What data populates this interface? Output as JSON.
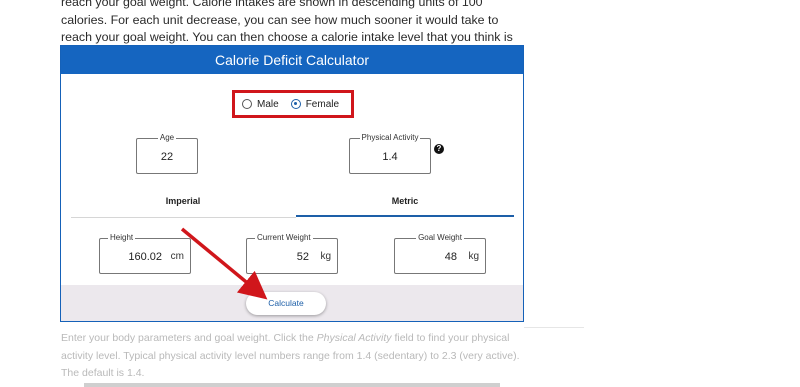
{
  "intro_text": "reach your goal weight. Calorie intakes are shown in descending units of 100 calories. For each unit decrease, you can see how much sooner it would take to reach your goal weight. You can then choose a calorie intake level that you think is doable and stick to it for that time.",
  "calculator": {
    "title": "Calorie Deficit Calculator",
    "gender": {
      "male_label": "Male",
      "female_label": "Female",
      "selected": "Female"
    },
    "age": {
      "label": "Age",
      "value": "22"
    },
    "activity": {
      "label": "Physical Activity",
      "value": "1.4",
      "help_icon": "?"
    },
    "tabs": {
      "imperial": "Imperial",
      "metric": "Metric",
      "active": "Metric"
    },
    "height": {
      "label": "Height",
      "value": "160.02",
      "unit": "cm"
    },
    "current_weight": {
      "label": "Current Weight",
      "value": "52",
      "unit": "kg"
    },
    "goal_weight": {
      "label": "Goal Weight",
      "value": "48",
      "unit": "kg"
    },
    "calculate_label": "Calculate"
  },
  "below_text": {
    "part1": "Enter your body parameters and goal weight. Click the ",
    "emph": "Physical Activity",
    "part2": " field to find your physical activity level. Typical physical activity level numbers range from 1.4 (sedentary) to 2.3 (very active). The default is 1.4."
  },
  "colors": {
    "header": "#1565c0",
    "highlight_box": "#d0161b",
    "arrow": "#d0161b",
    "footer_band": "#ece8ed"
  }
}
